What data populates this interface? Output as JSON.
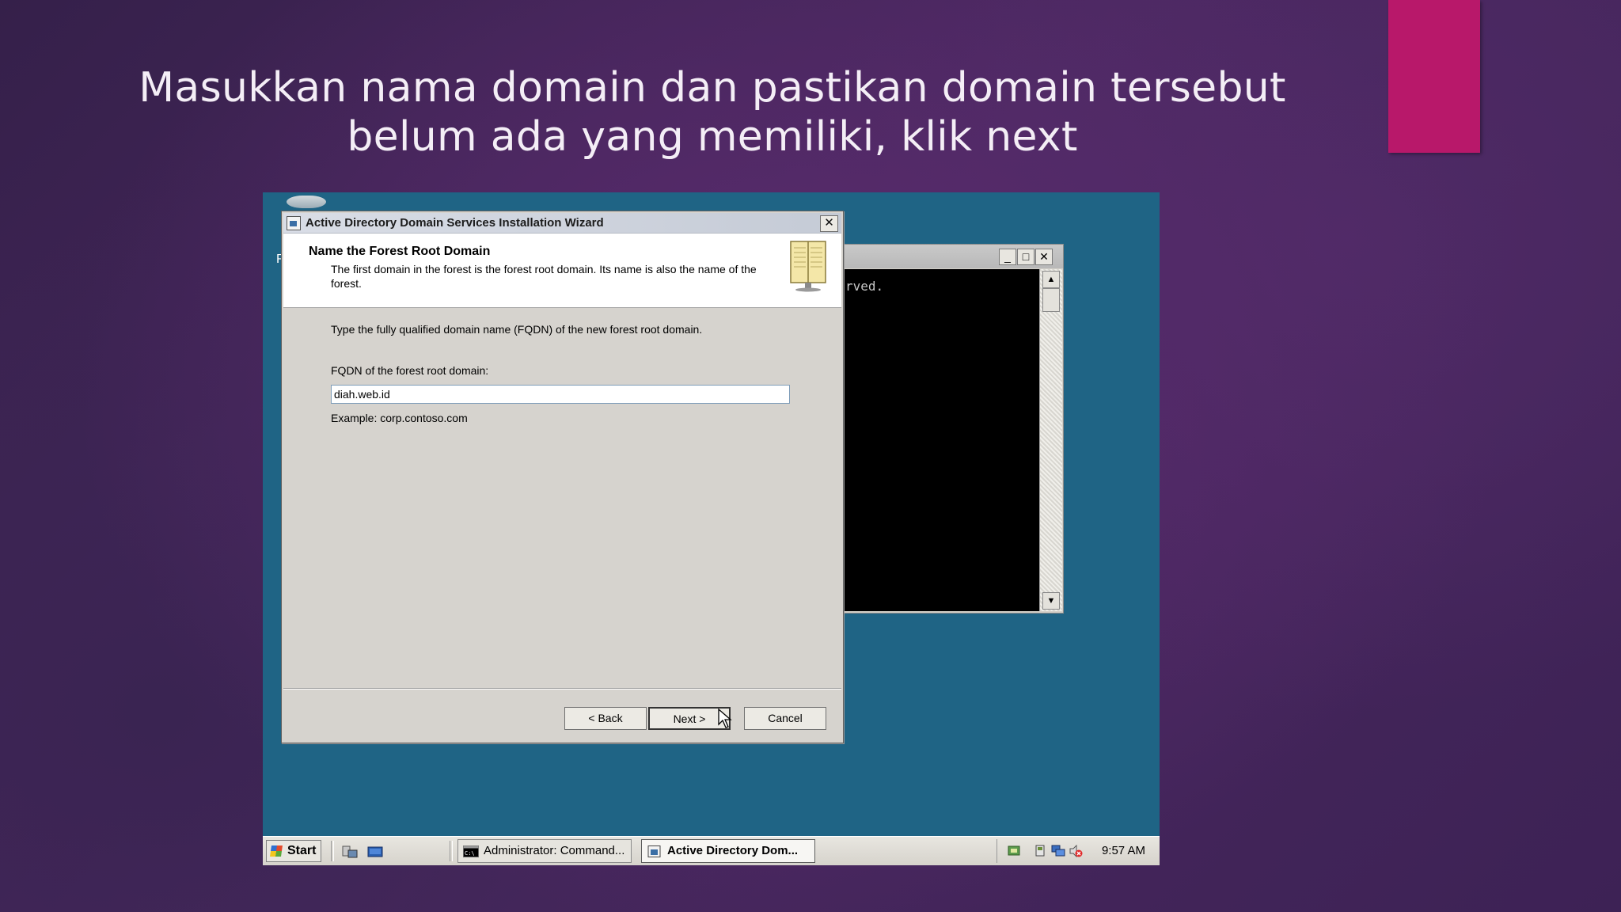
{
  "slide": {
    "title_line1": "Masukkan nama domain dan pastikan domain tersebut",
    "title_line2": "belum ada yang memiliki, klik next"
  },
  "console": {
    "visible_text": "rved."
  },
  "wizard": {
    "title": "Active Directory Domain Services Installation Wizard",
    "header_title": "Name the Forest Root Domain",
    "header_description": "The first domain in the forest is the forest root domain. Its name is also the name of the forest.",
    "prompt": "Type the fully qualified domain name (FQDN) of the new forest root domain.",
    "field_label": "FQDN of the forest root domain:",
    "field_value": "diah.web.id",
    "example": "Example: corp.contoso.com",
    "buttons": {
      "back": "< Back",
      "next": "Next >",
      "cancel": "Cancel"
    }
  },
  "taskbar": {
    "start_label": "Start",
    "tasks": [
      {
        "label": "Administrator: Command...",
        "active": false
      },
      {
        "label": "Active Directory Dom...",
        "active": true
      }
    ],
    "clock": "9:57 AM"
  },
  "colors": {
    "accent": "#b8186a",
    "desktop": "#1f6485"
  }
}
